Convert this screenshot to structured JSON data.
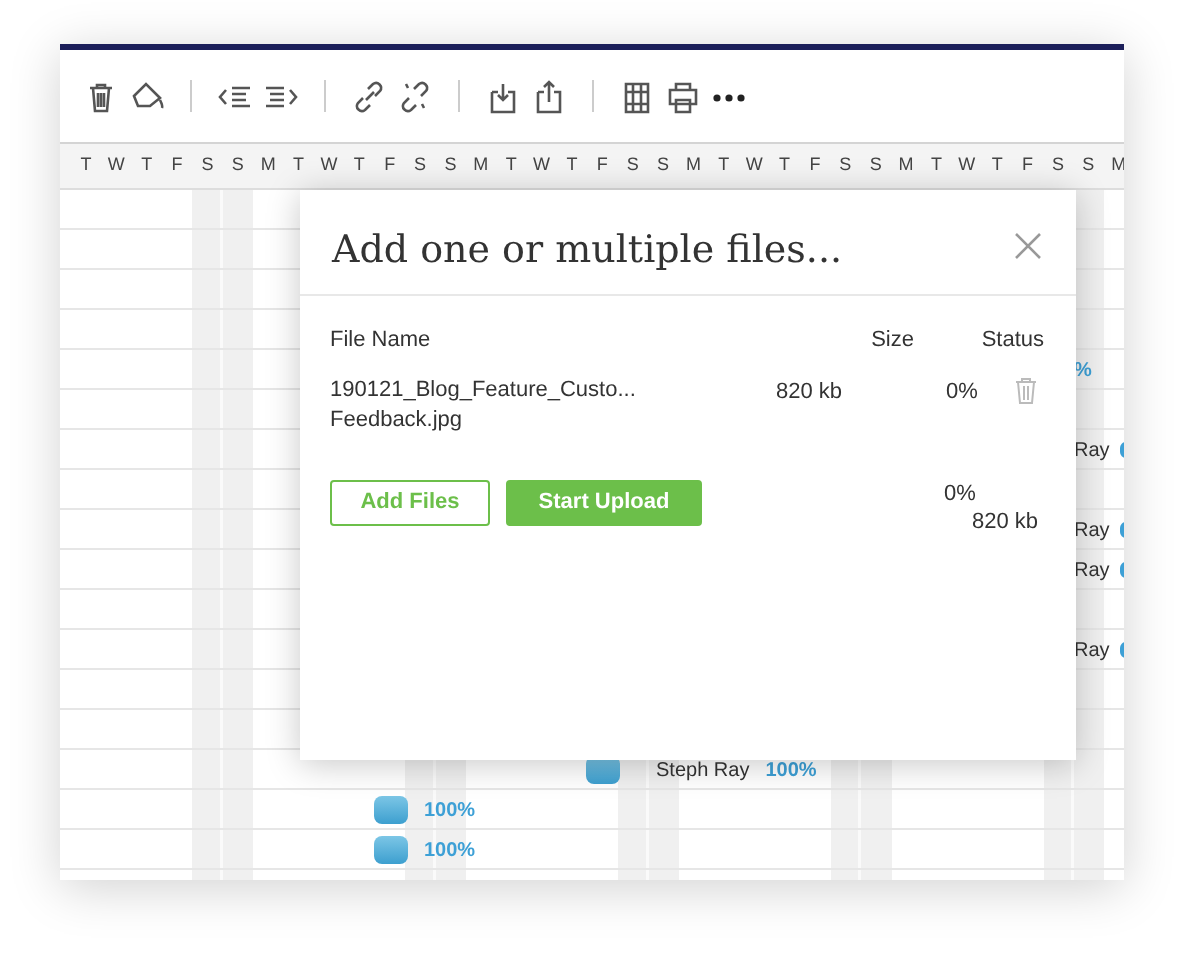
{
  "timeline": {
    "days": [
      "T",
      "W",
      "T",
      "F",
      "S",
      "S",
      "M",
      "T",
      "W",
      "T",
      "F",
      "S",
      "S",
      "M",
      "T",
      "W",
      "T",
      "F",
      "S",
      "S",
      "M",
      "T",
      "W",
      "T",
      "F",
      "S",
      "S",
      "M",
      "T",
      "W",
      "T",
      "F",
      "S",
      "S",
      "M"
    ]
  },
  "tasks": [
    {
      "kind": "cut",
      "text": "%"
    },
    {
      "kind": "cut",
      "text": "Ray"
    },
    {
      "kind": "cut",
      "text": "Ray"
    },
    {
      "kind": "cut",
      "text": "Ray"
    },
    {
      "kind": "cut",
      "text": "Ray"
    },
    {
      "kind": "bar",
      "assignee": "Steph Ray",
      "progress": "100%"
    },
    {
      "kind": "bar",
      "progress": "100%"
    },
    {
      "kind": "bar",
      "progress": "100%"
    }
  ],
  "dialog": {
    "title": "Add one or multiple files...",
    "columns": [
      "File Name",
      "Size",
      "Status"
    ],
    "files": [
      {
        "name_lines": [
          "190121_Blog_Feature_Custo...",
          "Feedback.jpg"
        ],
        "size": "820 kb",
        "status": "0%"
      }
    ],
    "buttons": [
      {
        "label": "Add Files",
        "kind": "outline"
      },
      {
        "label": "Start Upload",
        "kind": "primary"
      }
    ],
    "total": {
      "status": "0%",
      "size": "820 kb"
    }
  }
}
